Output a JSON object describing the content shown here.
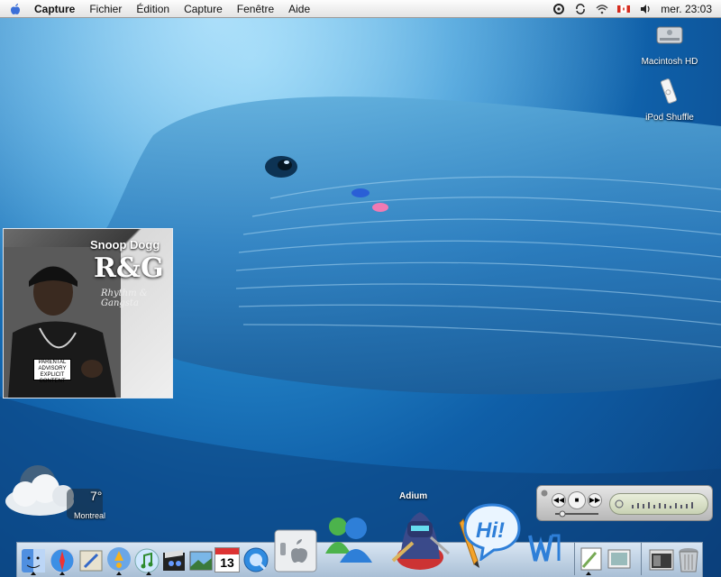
{
  "menubar": {
    "app_name": "Capture",
    "menus": [
      "Fichier",
      "Édition",
      "Capture",
      "Fenêtre",
      "Aide"
    ],
    "clock": "mer. 23:03",
    "status_icons": [
      "script-icon",
      "sync-icon",
      "wifi-icon",
      "canada-flag-icon",
      "volume-icon"
    ]
  },
  "desktop_icons": [
    {
      "label": "Macintosh HD",
      "icon": "hard-drive-icon"
    },
    {
      "label": "iPod Shuffle",
      "icon": "ipod-shuffle-icon"
    }
  ],
  "album_widget": {
    "artist": "Snoop Dogg",
    "title": "R&G",
    "subtitle": "Rhythm & Gangsta",
    "advisory": "PARENTAL ADVISORY EXPLICIT CONTENT"
  },
  "weather_widget": {
    "temperature": "7°",
    "city": "Montreal"
  },
  "dock": {
    "hover_label": "Adium",
    "items": [
      {
        "name": "finder",
        "icon": "finder-icon"
      },
      {
        "name": "safari",
        "icon": "safari-icon"
      },
      {
        "name": "mail",
        "icon": "mail-icon"
      },
      {
        "name": "ichat",
        "icon": "ichat-icon"
      },
      {
        "name": "itunes",
        "icon": "itunes-icon"
      },
      {
        "name": "imovie",
        "icon": "imovie-icon"
      },
      {
        "name": "iphoto",
        "icon": "iphoto-icon"
      },
      {
        "name": "ical",
        "icon": "ical-icon",
        "label": "13"
      },
      {
        "name": "quicktime",
        "icon": "quicktime-icon"
      },
      {
        "name": "system-preferences",
        "icon": "apple-switch-icon"
      },
      {
        "name": "msn-messenger",
        "icon": "msn-messenger-icon"
      },
      {
        "name": "adium",
        "icon": "adium-icon"
      },
      {
        "name": "text-editor",
        "icon": "pencil-icon"
      },
      {
        "name": "hi-chat",
        "icon": "hi-bubble-icon",
        "label": "Hi!"
      },
      {
        "name": "word",
        "icon": "word-icon"
      },
      {
        "name": "preview",
        "icon": "preview-icon"
      },
      {
        "name": "image-capture",
        "icon": "image-capture-icon"
      },
      {
        "name": "minimized-window",
        "icon": "window-thumbnail-icon"
      },
      {
        "name": "trash",
        "icon": "trash-icon"
      }
    ]
  },
  "colors": {
    "desktop_blue": "#0f5fa8",
    "menubar": "#ececec",
    "dock": "#c2d4e8"
  }
}
